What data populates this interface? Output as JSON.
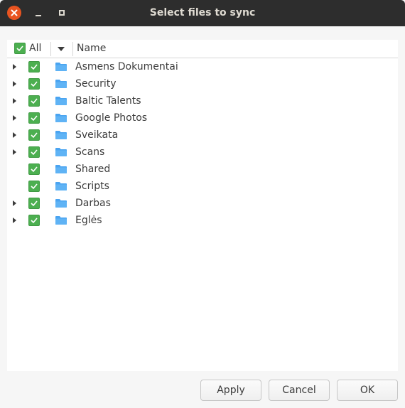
{
  "window": {
    "title": "Select files to sync"
  },
  "header": {
    "all_label": "All",
    "name_label": "Name"
  },
  "items": [
    {
      "name": "Asmens Dokumentai",
      "expandable": true,
      "checked": true
    },
    {
      "name": "Security",
      "expandable": true,
      "checked": true
    },
    {
      "name": "Baltic Talents",
      "expandable": true,
      "checked": true
    },
    {
      "name": "Google Photos",
      "expandable": true,
      "checked": true
    },
    {
      "name": "Sveikata",
      "expandable": true,
      "checked": true
    },
    {
      "name": "Scans",
      "expandable": true,
      "checked": true
    },
    {
      "name": "Shared",
      "expandable": false,
      "checked": true
    },
    {
      "name": "Scripts",
      "expandable": false,
      "checked": true
    },
    {
      "name": "Darbas",
      "expandable": true,
      "checked": true
    },
    {
      "name": "Eglės",
      "expandable": true,
      "checked": true
    }
  ],
  "buttons": {
    "apply": "Apply",
    "cancel": "Cancel",
    "ok": "OK"
  },
  "colors": {
    "check": "#4caf50",
    "folder": "#4aa4f1",
    "close": "#e95420",
    "titlebar": "#2d2d2d"
  }
}
